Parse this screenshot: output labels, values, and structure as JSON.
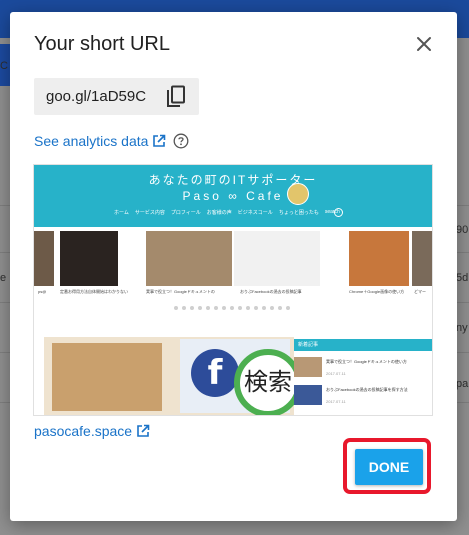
{
  "dialog": {
    "title": "Your short URL",
    "short_url": "goo.gl/1aD59C",
    "analytics_label": "See analytics data",
    "domain_label": "pasocafe.space",
    "done_label": "DONE"
  },
  "preview": {
    "tagline": "あなたの町のITサポーター",
    "brand": "Paso ∞ Cafe",
    "nav": [
      "ホーム",
      "サービス内容",
      "プロフィール",
      "お客様の声",
      "ビジネスコール",
      "ちょっと困ったも",
      "search"
    ],
    "thumb_captions": [
      "ps@",
      "定番お得用方法自体開始はわかりない",
      "実事で役立つ！Googleドキュメントの",
      "おりぶFacebookの過去の投稿記事",
      "Chrome＋Google画像の使い方",
      "どマー"
    ],
    "fb_glyph": "f",
    "kensaku_glyph": "検索",
    "sidebar_heading": "新着記事",
    "sidebar_items": [
      {
        "text": "実事で役立つ！Googleドキュメントの使い方",
        "date": "2017.07.11"
      },
      {
        "text": "おりぶFacebookの過去の投稿記事を探す方法",
        "date": "2017.07.11"
      }
    ]
  },
  "background": {
    "row_fragments": [
      "C",
      "e",
      "5d",
      "ny",
      "pa",
      "90"
    ]
  },
  "colors": {
    "accent": "#1aa2ea",
    "link": "#1a73c8",
    "highlight": "#e8182c",
    "site_header": "#27b2c9"
  }
}
